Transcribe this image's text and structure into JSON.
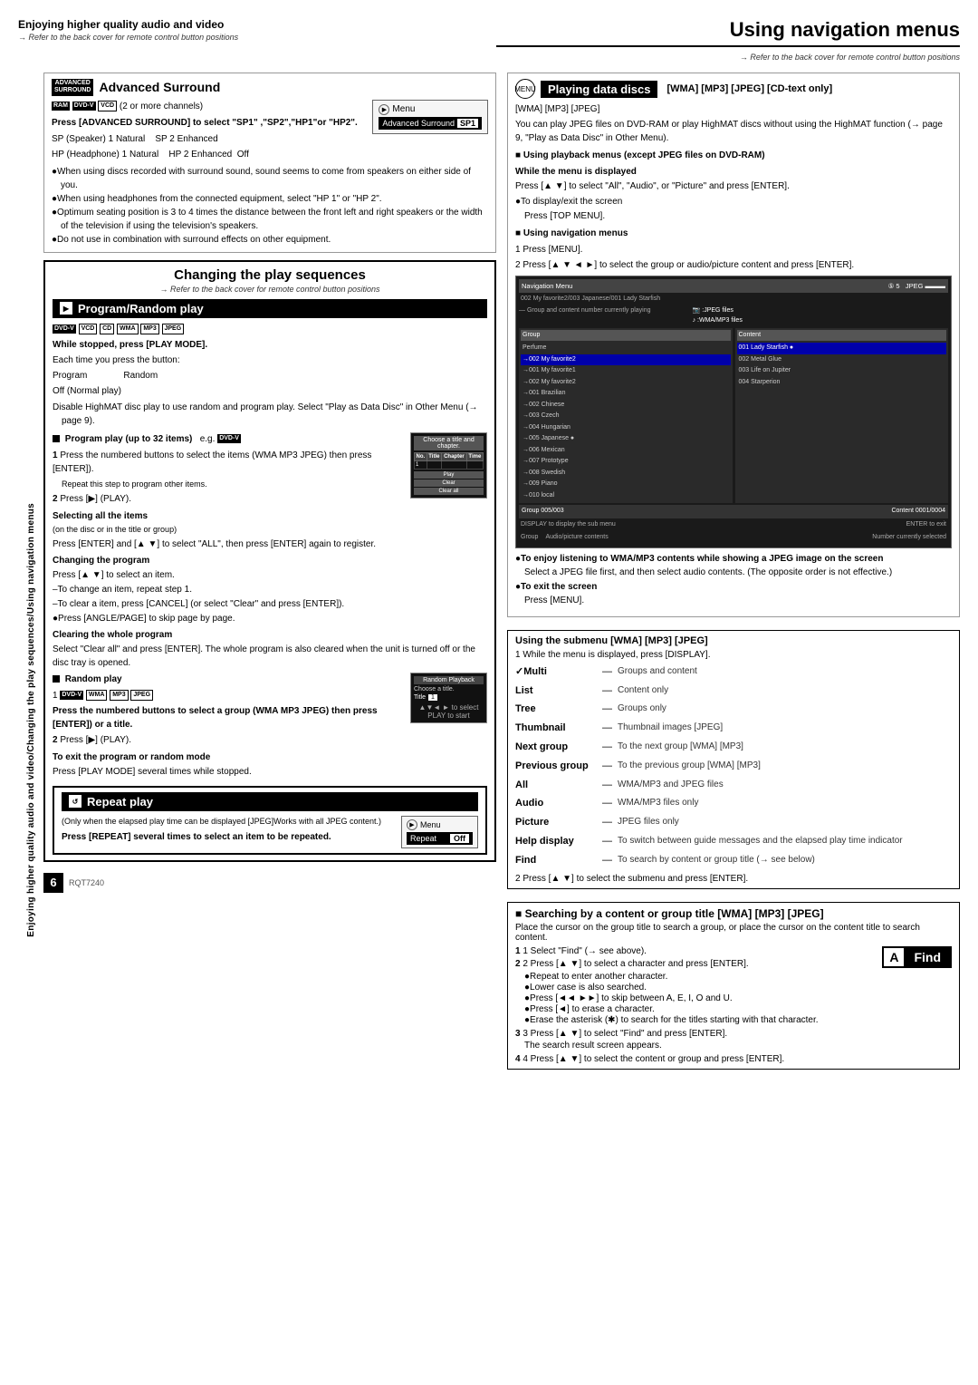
{
  "page": {
    "title": "Using navigation menus",
    "page_number": "6",
    "doc_id": "RQT7240"
  },
  "left_section": {
    "top_heading": "Enjoying higher quality audio and video",
    "top_ref": "→ Refer to the back cover for remote control button positions",
    "adv_surround": {
      "title": "Advanced Surround",
      "badge_text": "ADVANCED SURROUND",
      "disc_types": "RAM DVD-V VCD (2 or more channels)",
      "press_instruction": "Press [ADVANCED SURROUND] to select \"SP1\" ,\"SP2\",\"HP1\"or \"HP2\".",
      "sp1_label": "SP (Speaker) 1 Natural",
      "sp2_label": "SP 2 Enhanced",
      "hp1_label": "HP (Headphone) 1 Natural",
      "hp2_label": "HP 2 Enhanced",
      "hp2_off": "Off",
      "menu_title": "Menu",
      "menu_subtitle": "Advanced Surround",
      "menu_badge": "SP1",
      "bullets": [
        "When using discs recorded with surround sound, sound seems to come from speakers on either side of you.",
        "When using headphones from the connected equipment, select \"HP 1\" or \"HP 2\".",
        "Optimum seating position is 3 to 4 times the distance between the front left and right speakers or the width of the television if using the television's speakers.",
        "Do not use in combination with surround effects on other equipment."
      ]
    },
    "changing_play": {
      "title": "Changing the play sequences",
      "ref": "→ Refer to the back cover for remote control button positions",
      "program_random": {
        "title": "Program/Random play",
        "badge": "PLAY MODE",
        "disc_types": "DVD-V VCD CD WMA MP3 JPEG",
        "while_stopped": "While stopped, press [PLAY MODE].",
        "each_time": "Each time you press the button:",
        "program_label": "Program",
        "random_label": "Random",
        "off_label": "Off (Normal play)",
        "disable_note": "Disable HighMAT disc play to use random and program play. Select \"Play as Data Disc\" in Other Menu (→ page 9).",
        "program_play_heading": "Program play (up to 32 items)",
        "eg_label": "e.g.",
        "eg_badge": "DVD-V",
        "step1": "Press the numbered buttons to select the items (WMA MP3 JPEG) then press [ENTER]).",
        "step1_note": "Repeat this step to program other items.",
        "step2": "Press [▶] (PLAY).",
        "selecting_all": "Selecting all the items",
        "on_disc": "(on the disc or in the title or group)",
        "select_all_note": "Press [ENTER] and [▲ ▼] to select \"ALL\", then press [ENTER] again to register.",
        "changing_program": "Changing the program",
        "change_program_note": "Press [▲ ▼] to select an item.",
        "change_item_note": "–To change an item, repeat step 1.",
        "clear_item_note": "–To clear a item, press [CANCEL] (or select \"Clear\" and press [ENTER]).",
        "angle_note": "●Press [ANGLE/PAGE] to skip page by page.",
        "clearing_whole": "Clearing the whole program",
        "clear_whole_note": "Select \"Clear all\" and press [ENTER]. The whole program is also cleared when the unit is turned off or the disc tray is opened.",
        "random_play_heading": "Random play",
        "rand_disc_types": "DVD-V WMA MP3 JPEG",
        "rand_eg_badge": "DVD-V",
        "rand_step1": "Press the numbered buttons to select a group (WMA MP3 JPEG) then press [ENTER]) or a title.",
        "rand_step2": "Press [▶] (PLAY).",
        "to_exit": "To exit the program or random mode",
        "exit_note": "Press [PLAY MODE] several times while stopped.",
        "prog_choose_header": "Choose a title and chapter.",
        "prog_choose_cols": [
          "No.",
          "Title",
          "Chapter",
          "Time"
        ],
        "prog_choose_rows": [
          [
            "1",
            "",
            "",
            ""
          ]
        ],
        "prog_choose_btns": [
          "Play",
          "Clear",
          "Clear all"
        ],
        "rand_playback_title": "Random Playback",
        "rand_choose_label": "Choose a title.",
        "rand_title_label": "Title",
        "rand_title_val": "1",
        "rand_ctrl": "▲▼◄ ► to select   PLAY to start"
      },
      "repeat_play": {
        "title": "Repeat play",
        "badge": "REPEAT",
        "note1": "(Only when the elapsed play time can be displayed [JPEG]Works with all JPEG content.)",
        "instruction": "Press [REPEAT] several times to select an item to be repeated.",
        "menu_title": "Menu",
        "menu_sub": "Repeat",
        "off_label": "Off"
      }
    }
  },
  "right_section": {
    "ref": "→ Refer to the back cover for remote control button positions",
    "playing_data_discs": {
      "title": "Playing data discs",
      "disc_types": "[WMA] [MP3] [JPEG] [CD-text only]",
      "wma_mp3_jpeg": "[WMA] [MP3] [JPEG]",
      "note": "You can play JPEG files on DVD-RAM or play HighMAT discs without using the HighMAT function (→ page 9, \"Play as Data Disc\" in Other Menu).",
      "playback_menus_heading": "■ Using playback menus (except JPEG files on DVD-RAM)",
      "while_menu_displayed": "While the menu is displayed",
      "press_instruction": "Press [▲ ▼] to select \"All\", \"Audio\", or \"Picture\" and press [ENTER].",
      "display_exit": "●To display/exit the screen",
      "press_top_menu": "Press [TOP MENU].",
      "nav_menus_heading": "■ Using navigation menus",
      "step1": "1   Press [MENU].",
      "step2": "2   Press [▲ ▼ ◄ ►] to select the group or audio/picture content and press [ENTER].",
      "group_content_note": "Group and content number currently playing",
      "jpeg_files_note": ":JPEG files",
      "wma_mp3_note": ":WMA/MP3 files",
      "num_selected_note": "Number currently selected",
      "group_label": "Group",
      "audio_pic_label": "Audio/picture contents",
      "enjoy_note": "●To enjoy listening to WMA/MP3 contents while showing a JPEG image on the screen",
      "enjoy_desc": "Select a JPEG file first, and then select audio contents. (The opposite order is not effective.)",
      "exit_screen": "●To exit the screen",
      "press_menu": "Press [MENU]."
    },
    "using_submenu": {
      "title": "Using the submenu [WMA] [MP3] [JPEG]",
      "step1": "1   While the menu is displayed, press [DISPLAY].",
      "menu_items": [
        {
          "label": "✓Multi",
          "desc": "Groups and content"
        },
        {
          "label": "List",
          "desc": "Content only"
        },
        {
          "label": "Tree",
          "desc": "Groups only"
        },
        {
          "label": "Thumbnail",
          "desc": "Thumbnail images [JPEG]"
        },
        {
          "label": "Next group",
          "desc": "To the next group [WMA] [MP3]"
        },
        {
          "label": "Previous group",
          "desc": "To the previous group [WMA] [MP3]"
        },
        {
          "label": "All",
          "desc": "WMA/MP3 and JPEG files"
        },
        {
          "label": "Audio",
          "desc": "WMA/MP3 files only"
        },
        {
          "label": "Picture",
          "desc": "JPEG files only"
        },
        {
          "label": "Help display",
          "desc": "To switch between guide messages and the elapsed play time indicator"
        },
        {
          "label": "Find",
          "desc": "To search by content or group title (→ see below)"
        }
      ],
      "step2": "2   Press [▲ ▼] to select the submenu and press [ENTER]."
    },
    "searching": {
      "title": "■ Searching by a content or group title [WMA] [MP3] [JPEG]",
      "note1": "Place the cursor on the group title to search a group, or place the cursor on the content title to search content.",
      "step1": "1   Select \"Find\"",
      "see_above": "(→ see above).",
      "find_a_label": "A",
      "find_label": "Find",
      "step2": "2   Press [▲ ▼] to select a character and press [ENTER].",
      "bullet1": "●Repeat to enter another character.",
      "bullet2": "●Lower case is also searched.",
      "bullet3": "●Press [◄◄ ►►] to skip between A, E, I, O and U.",
      "bullet4": "●Press [◄] to erase a character.",
      "bullet5": "●Erase the asterisk (✱) to search for the titles starting with that character.",
      "step3": "3   Press [▲ ▼] to select \"Find\" and press [ENTER].",
      "step3_note": "The search result screen appears.",
      "step4": "4   Press [▲ ▼] to select the content or group and press [ENTER]."
    },
    "nav_screenshot": {
      "header": "Navigation Menu",
      "disc_info": "5   JPEG",
      "path": "002 My favorite2/003 Japanese/001 Lady Starfish",
      "left_groups": [
        "Perfume",
        "→002 My favorite2",
        "→001 My favorite1",
        "→002 My favorite2",
        "→001 Brazilian",
        "→002 Chinese",
        "→003 Czech",
        "→004 Hungarian",
        "→005 Japanese ●",
        "→006 Mexican",
        "→007 Prototype",
        "→008 Swedish",
        "→009 Piano",
        "→010 local"
      ],
      "right_items": [
        "001 Lady Starfish ●",
        "002 Metal Glue",
        "003 Life on Jupiter",
        "004 Starperion"
      ],
      "group_info": "Group 005/003",
      "content_info": "Content 0001/0004",
      "footer_display": "DISPLAY to display the sub menu",
      "footer_enter": "ENTER to exit"
    }
  }
}
